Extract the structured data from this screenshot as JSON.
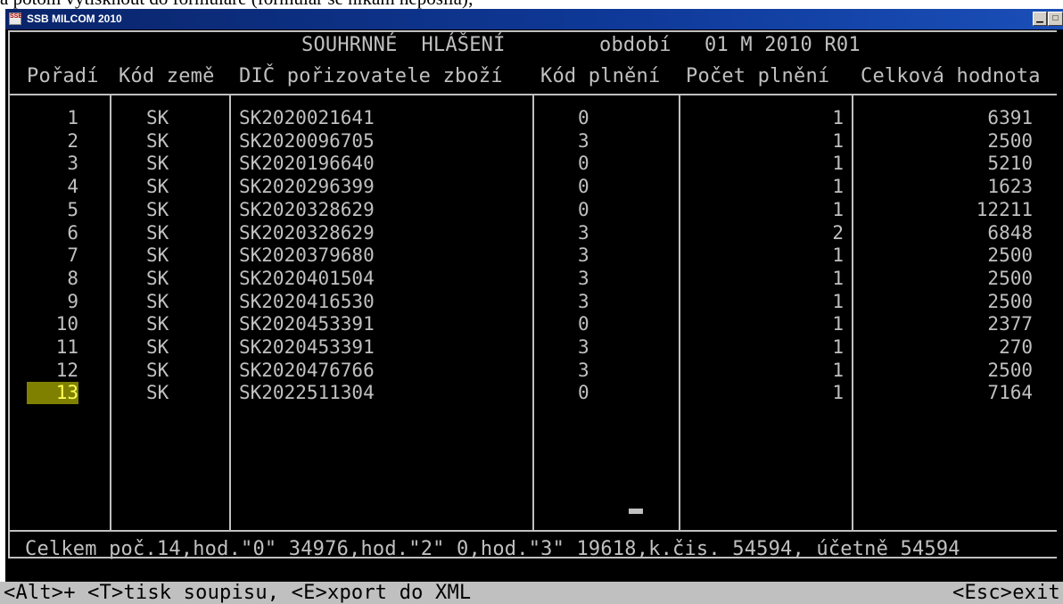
{
  "page_top_text": "a potom vytisknout do formuláře (formulář se nikam neposílá);",
  "window": {
    "title": "SSB MILCOM 2010",
    "icon_text": "SSB"
  },
  "header": {
    "report_title": "SOUHRNNÉ  HLÁŠENÍ",
    "period_label": "období",
    "period_value": "01 M 2010 R01"
  },
  "columns": [
    "Pořadí",
    "Kód země",
    "DIČ pořizovatele zboží",
    "Kód plnění",
    "Počet plnění",
    "Celková hodnota"
  ],
  "rows": [
    {
      "order": "1",
      "country": "SK",
      "vat": "SK2020021641",
      "code": "0",
      "count": "1",
      "total": "6391"
    },
    {
      "order": "2",
      "country": "SK",
      "vat": "SK2020096705",
      "code": "3",
      "count": "1",
      "total": "2500"
    },
    {
      "order": "3",
      "country": "SK",
      "vat": "SK2020196640",
      "code": "0",
      "count": "1",
      "total": "5210"
    },
    {
      "order": "4",
      "country": "SK",
      "vat": "SK2020296399",
      "code": "0",
      "count": "1",
      "total": "1623"
    },
    {
      "order": "5",
      "country": "SK",
      "vat": "SK2020328629",
      "code": "0",
      "count": "1",
      "total": "12211"
    },
    {
      "order": "6",
      "country": "SK",
      "vat": "SK2020328629",
      "code": "3",
      "count": "2",
      "total": "6848"
    },
    {
      "order": "7",
      "country": "SK",
      "vat": "SK2020379680",
      "code": "3",
      "count": "1",
      "total": "2500"
    },
    {
      "order": "8",
      "country": "SK",
      "vat": "SK2020401504",
      "code": "3",
      "count": "1",
      "total": "2500"
    },
    {
      "order": "9",
      "country": "SK",
      "vat": "SK2020416530",
      "code": "3",
      "count": "1",
      "total": "2500"
    },
    {
      "order": "10",
      "country": "SK",
      "vat": "SK2020453391",
      "code": "0",
      "count": "1",
      "total": "2377"
    },
    {
      "order": "11",
      "country": "SK",
      "vat": "SK2020453391",
      "code": "3",
      "count": "1",
      "total": "270"
    },
    {
      "order": "12",
      "country": "SK",
      "vat": "SK2020476766",
      "code": "3",
      "count": "1",
      "total": "2500"
    },
    {
      "order": "13",
      "country": "SK",
      "vat": "SK2022511304",
      "code": "0",
      "count": "1",
      "total": "7164"
    }
  ],
  "selected_row": 13,
  "summary": "Celkem poč.14,hod.\"0\" 34976,hod.\"2\" 0,hod.\"3\" 19618,k.čis. 54594, účetně 54594",
  "status": {
    "left": "<Alt>+ <T>tisk soupisu, <E>xport do XML",
    "right": "<Esc>exit"
  },
  "colors": {
    "console_bg": "#000000",
    "console_fg": "#c0c0c0",
    "selection_bg": "#808000",
    "selection_fg": "#ffff55",
    "titlebar": "#0a246a"
  }
}
